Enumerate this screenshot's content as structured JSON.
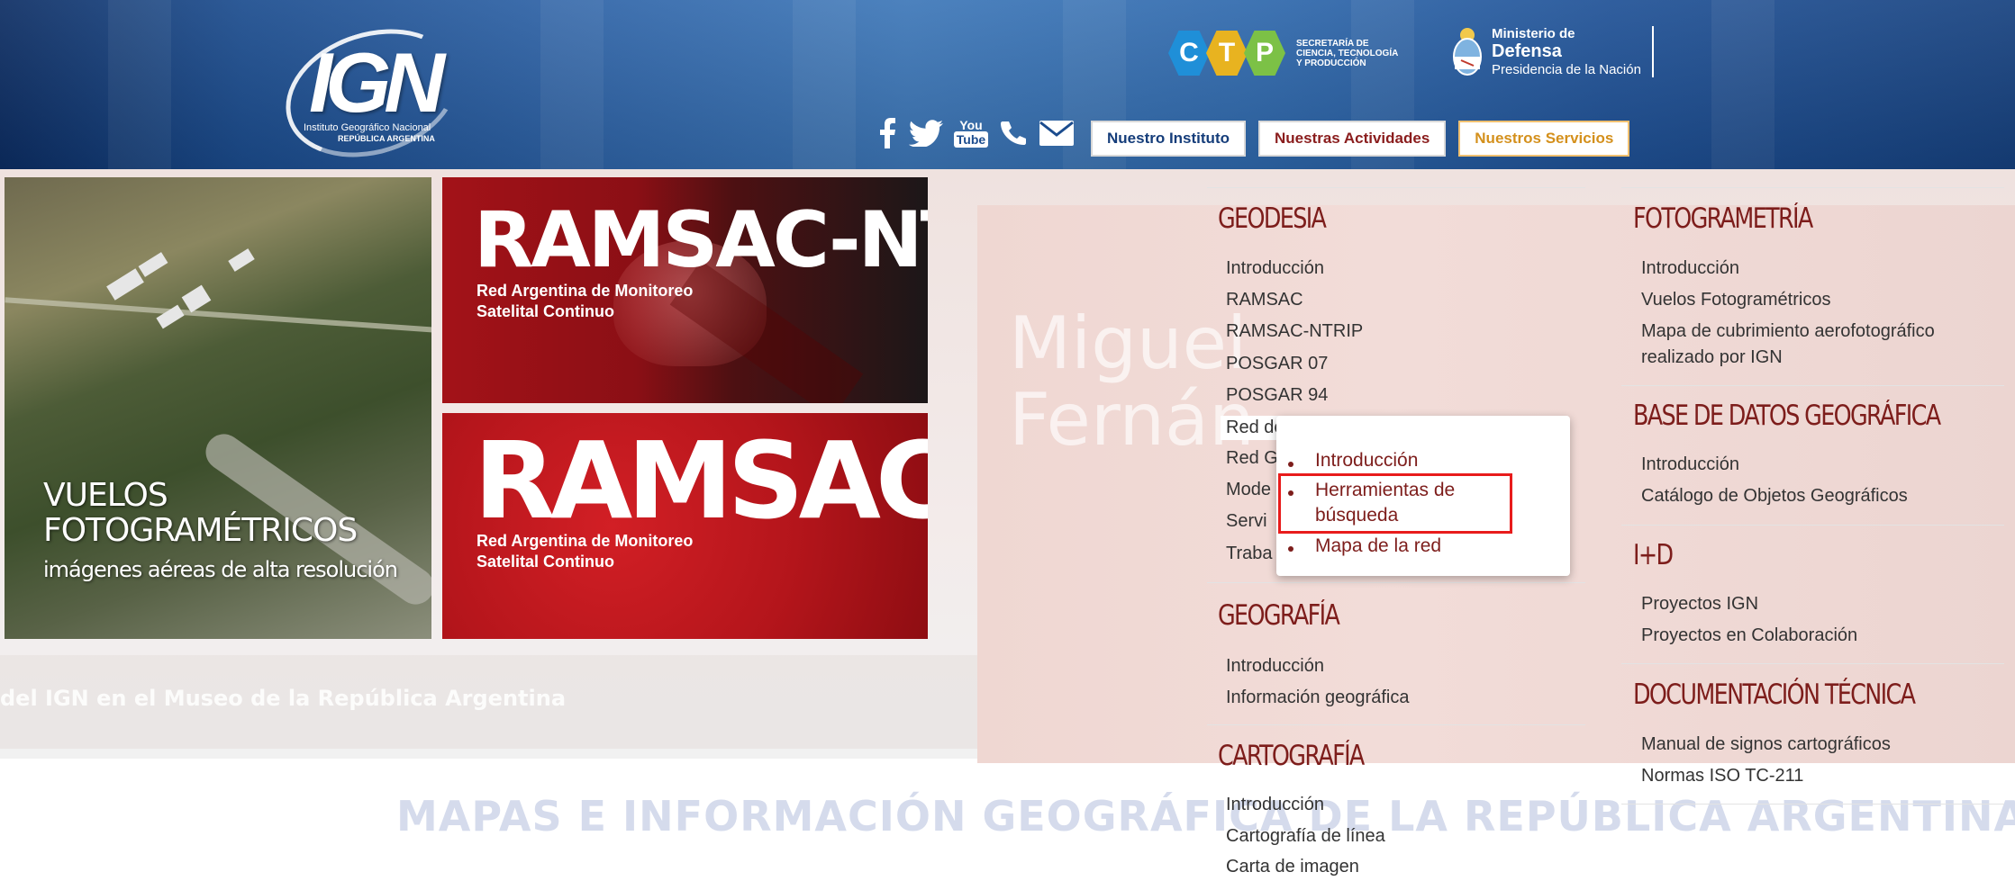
{
  "header": {
    "logo": {
      "text": "IGN",
      "subtitle": "Instituto Geográfico Nacional",
      "country": "REPÚBLICA ARGENTINA"
    },
    "ctp": {
      "letters": [
        "C",
        "T",
        "P"
      ],
      "colors": [
        "#1f8fd8",
        "#e8b320",
        "#7cc146"
      ],
      "text_lines": [
        "SECRETARÍA DE",
        "CIENCIA, TECNOLOGÍA",
        "Y PRODUCCIÓN"
      ]
    },
    "ministry": {
      "line1": "Ministerio de",
      "line2": "Defensa",
      "line3": "Presidencia de la Nación"
    },
    "social": {
      "icons": [
        "facebook-icon",
        "twitter-icon",
        "youtube-icon",
        "phone-icon",
        "mail-icon"
      ],
      "youtube_top": "You",
      "youtube_bottom": "Tube"
    },
    "nav": [
      {
        "label": "Nuestro Instituto",
        "color": "#153d7a",
        "border": "#d8d8d8"
      },
      {
        "label": "Nuestras Actividades",
        "color": "#8a1d1d",
        "border": "#d8d8d8"
      },
      {
        "label": "Nuestros Servicios",
        "color": "#d4901c",
        "border": "#f0c070"
      }
    ]
  },
  "tiles": {
    "vuelos": {
      "line1": "VUELOS",
      "line2": "FOTOGRAMÉTRICOS",
      "line3": "imágenes aéreas de alta resolución"
    },
    "ramsac_ntrip": {
      "title": "RAMSAC-NTRIP",
      "sub1": "Red Argentina de Monitoreo",
      "sub2": "Satelital Continuo"
    },
    "ramsac": {
      "title": "RAMSAC",
      "sub1": "Red Argentina de Monitoreo",
      "sub2": "Satelital Continuo"
    }
  },
  "background": {
    "ghost_line1": "Miguel",
    "ghost_line2": "Fernán",
    "ghost_sub": "...",
    "caption": "del IGN en el Museo de la República Argentina",
    "bottom_title": "MAPAS E INFORMACIÓN GEOGRÁFICA DE LA REPÚBLICA ARGENTINA"
  },
  "menu": {
    "geodesia": {
      "title": "GEODESIA",
      "items": [
        "Introducción",
        "RAMSAC",
        "RAMSAC-NTRIP",
        "POSGAR 07",
        "POSGAR 94",
        "Red de Nivelación"
      ],
      "truncated": [
        "Red G",
        "Mode",
        "Servi",
        "Traba"
      ]
    },
    "red_nivelacion_submenu": {
      "items": [
        "Introducción",
        "Herramientas de",
        "búsqueda",
        "Mapa de la red"
      ]
    },
    "geografia": {
      "title": "GEOGRAFÍA",
      "items": [
        "Introducción",
        "Información geográfica"
      ]
    },
    "cartografia": {
      "title": "CARTOGRAFÍA",
      "items": [
        "Introducción",
        "Cartografía de línea",
        "Carta de imagen"
      ]
    },
    "fotogrametria": {
      "title": "FOTOGRAMETRÍA",
      "items": [
        "Introducción",
        "Vuelos Fotogramétricos",
        "Mapa de cubrimiento aerofotográfico",
        "realizado por IGN"
      ]
    },
    "base_datos": {
      "title": "BASE DE DATOS GEOGRÁFICA",
      "items": [
        "Introducción",
        "Catálogo de Objetos Geográficos"
      ]
    },
    "id": {
      "title": "I+D",
      "items": [
        "Proyectos IGN",
        "Proyectos en Colaboración"
      ]
    },
    "documentacion": {
      "title": "DOCUMENTACIÓN TÉCNICA",
      "items": [
        "Manual de signos cartográficos",
        "Normas ISO TC-211"
      ]
    },
    "accent_color": "#7d1d1b",
    "highlight_color": "#e81c1c"
  }
}
